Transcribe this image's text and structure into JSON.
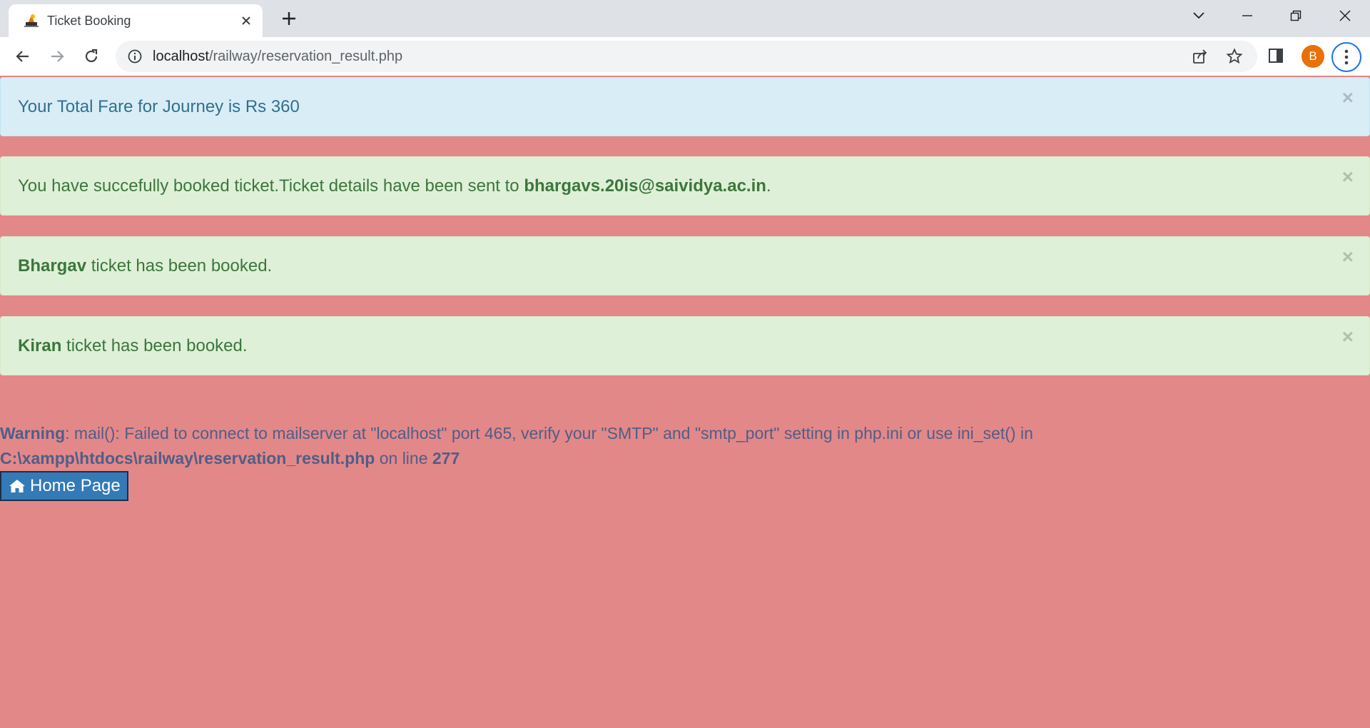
{
  "browser": {
    "tab_title": "Ticket Booking",
    "url_host": "localhost",
    "url_path": "/railway/reservation_result.php",
    "profile_initial": "B"
  },
  "alerts": {
    "fare": {
      "text": "Your Total Fare for Journey is Rs 360",
      "close": "×"
    },
    "email": {
      "prefix": "You have succefully booked ticket.Ticket details have been sent to ",
      "email": "bhargavs.20is@saividya.ac.in",
      "suffix": ".",
      "close": "×"
    },
    "passengers": [
      {
        "name": "Bhargav",
        "text": " ticket has been booked.",
        "close": "×"
      },
      {
        "name": "Kiran",
        "text": " ticket has been booked.",
        "close": "×"
      }
    ]
  },
  "warning": {
    "label": "Warning",
    "message": ": mail(): Failed to connect to mailserver at \"localhost\" port 465, verify your \"SMTP\" and \"smtp_port\" setting in php.ini or use ini_set() in",
    "file": "C:\\xampp\\htdocs\\railway\\reservation_result.php",
    "on_line": " on line ",
    "line": "277"
  },
  "home_button": {
    "label": "Home Page",
    "icon": "home-icon"
  },
  "colors": {
    "page_background": "#e38888",
    "info_alert": "#d9edf7",
    "success_alert": "#dff0d8",
    "button": "#337ab7"
  }
}
